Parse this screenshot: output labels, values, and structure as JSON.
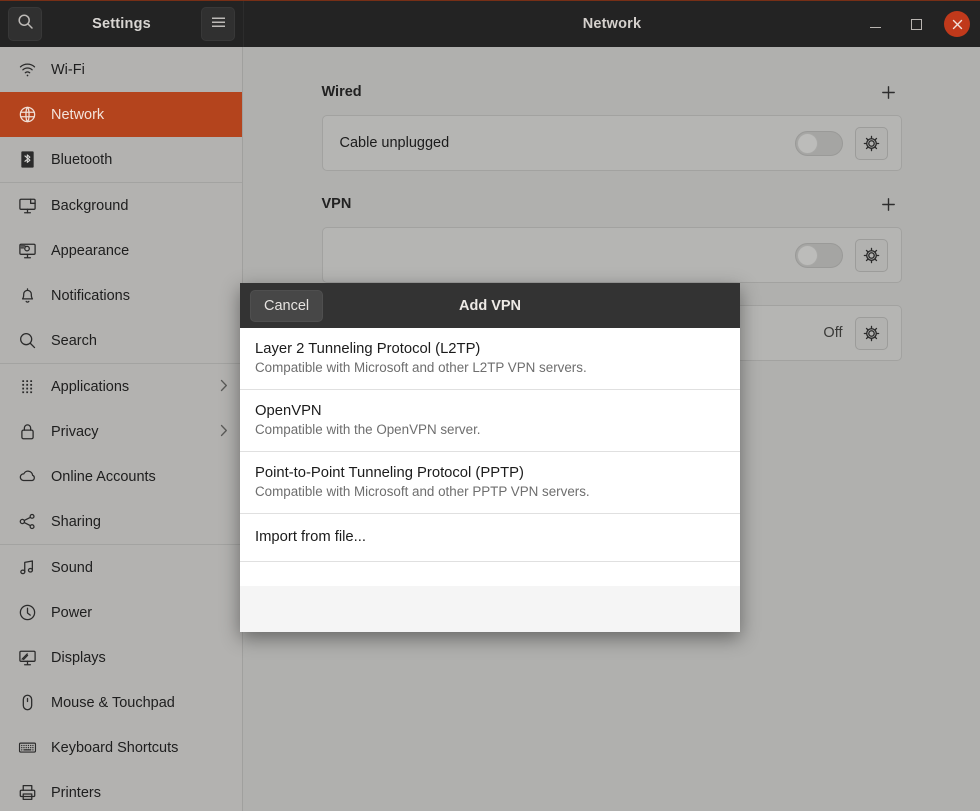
{
  "titlebar": {
    "settings_title": "Settings",
    "window_title": "Network",
    "search_icon": "search-icon",
    "menu_icon": "hamburger-menu-icon",
    "minimize_label": "Minimize",
    "maximize_label": "Maximize",
    "close_label": "Close"
  },
  "colors": {
    "accent": "#b4441d",
    "titlebar_bg": "#232323",
    "sidebar_bg": "#b3b2b0",
    "content_bg": "#b0b0ae",
    "close_button": "#c0391b",
    "modal_header_bg": "#333333"
  },
  "sidebar": {
    "items": [
      {
        "label": "Wi-Fi",
        "icon": "wifi-icon",
        "selected": false,
        "chevron": false
      },
      {
        "label": "Network",
        "icon": "globe-icon",
        "selected": true,
        "chevron": false
      },
      {
        "label": "Bluetooth",
        "icon": "bluetooth-icon",
        "selected": false,
        "chevron": false
      },
      {
        "label": "Background",
        "icon": "background-icon",
        "selected": false,
        "chevron": false
      },
      {
        "label": "Appearance",
        "icon": "appearance-icon",
        "selected": false,
        "chevron": false
      },
      {
        "label": "Notifications",
        "icon": "bell-icon",
        "selected": false,
        "chevron": false
      },
      {
        "label": "Search",
        "icon": "search-icon",
        "selected": false,
        "chevron": false
      },
      {
        "label": "Applications",
        "icon": "grid-apps-icon",
        "selected": false,
        "chevron": true
      },
      {
        "label": "Privacy",
        "icon": "lock-icon",
        "selected": false,
        "chevron": true
      },
      {
        "label": "Online Accounts",
        "icon": "cloud-icon",
        "selected": false,
        "chevron": false
      },
      {
        "label": "Sharing",
        "icon": "share-icon",
        "selected": false,
        "chevron": false
      },
      {
        "label": "Sound",
        "icon": "music-note-icon",
        "selected": false,
        "chevron": false
      },
      {
        "label": "Power",
        "icon": "power-icon",
        "selected": false,
        "chevron": false
      },
      {
        "label": "Displays",
        "icon": "display-icon",
        "selected": false,
        "chevron": false
      },
      {
        "label": "Mouse & Touchpad",
        "icon": "mouse-icon",
        "selected": false,
        "chevron": false
      },
      {
        "label": "Keyboard Shortcuts",
        "icon": "keyboard-icon",
        "selected": false,
        "chevron": false
      },
      {
        "label": "Printers",
        "icon": "printer-icon",
        "selected": false,
        "chevron": false
      }
    ],
    "separators_after": [
      2,
      6,
      10
    ]
  },
  "main": {
    "sections": [
      {
        "title": "Wired",
        "add_label": "+",
        "rows": [
          {
            "label": "Cable unplugged",
            "status": "",
            "toggle": true,
            "toggle_on": false,
            "gear": true
          }
        ]
      },
      {
        "title": "VPN",
        "add_label": "+",
        "rows": [
          {
            "label": "",
            "status": "",
            "toggle": true,
            "toggle_on": false,
            "gear": true
          },
          {
            "label": "",
            "status": "Off",
            "toggle": false,
            "toggle_on": false,
            "gear": true
          }
        ]
      }
    ]
  },
  "modal": {
    "title": "Add VPN",
    "cancel_label": "Cancel",
    "items": [
      {
        "name": "Layer 2 Tunneling Protocol (L2TP)",
        "desc": "Compatible with Microsoft and other L2TP VPN servers."
      },
      {
        "name": "OpenVPN",
        "desc": "Compatible with the OpenVPN server."
      },
      {
        "name": "Point-to-Point Tunneling Protocol (PPTP)",
        "desc": "Compatible with Microsoft and other PPTP VPN servers."
      }
    ],
    "import_label": "Import from file..."
  }
}
